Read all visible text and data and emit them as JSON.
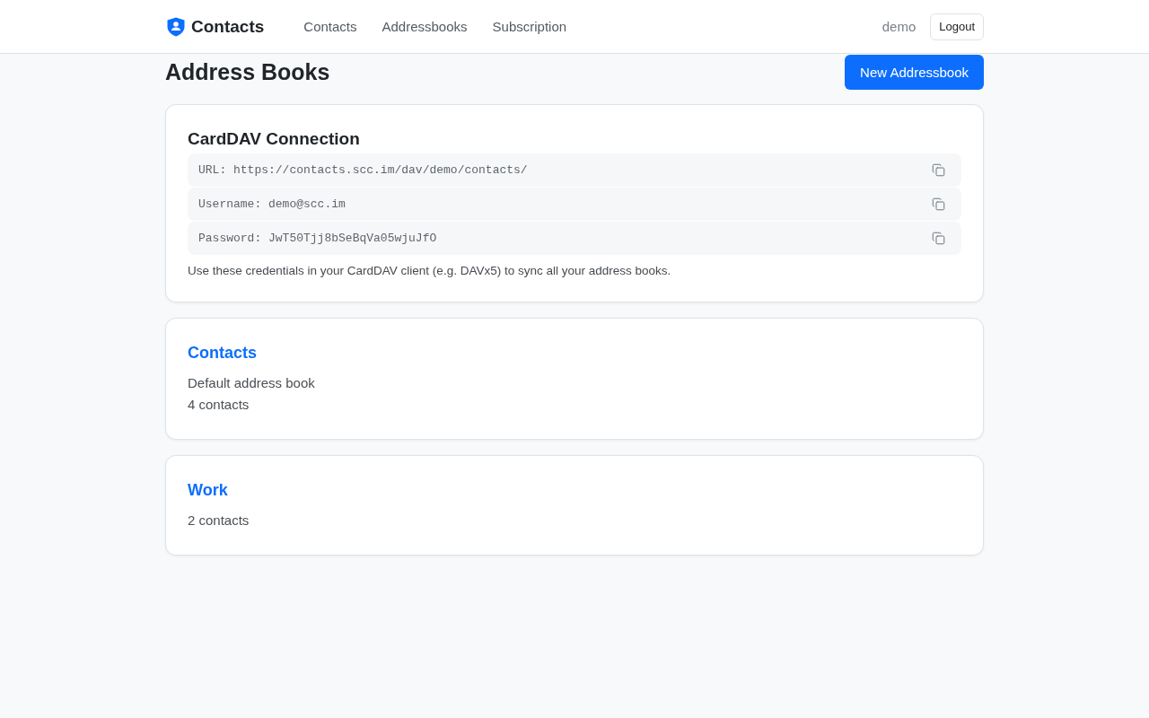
{
  "navbar": {
    "brand": "Contacts",
    "links": [
      "Contacts",
      "Addressbooks",
      "Subscription"
    ],
    "user": "demo",
    "logout": "Logout"
  },
  "page": {
    "title": "Address Books",
    "new_button": "New Addressbook"
  },
  "carddav": {
    "title": "CardDAV Connection",
    "fields": [
      "URL: https://contacts.scc.im/dav/demo/contacts/",
      "Username: demo@scc.im",
      "Password: JwT50Tjj8bSeBqVa05wjuJfO"
    ],
    "note": "Use these credentials in your CardDAV client (e.g. DAVx5) to sync all your address books."
  },
  "address_books": [
    {
      "name": "Contacts",
      "description": "Default address book",
      "count": "4 contacts"
    },
    {
      "name": "Work",
      "count": "2 contacts"
    }
  ]
}
